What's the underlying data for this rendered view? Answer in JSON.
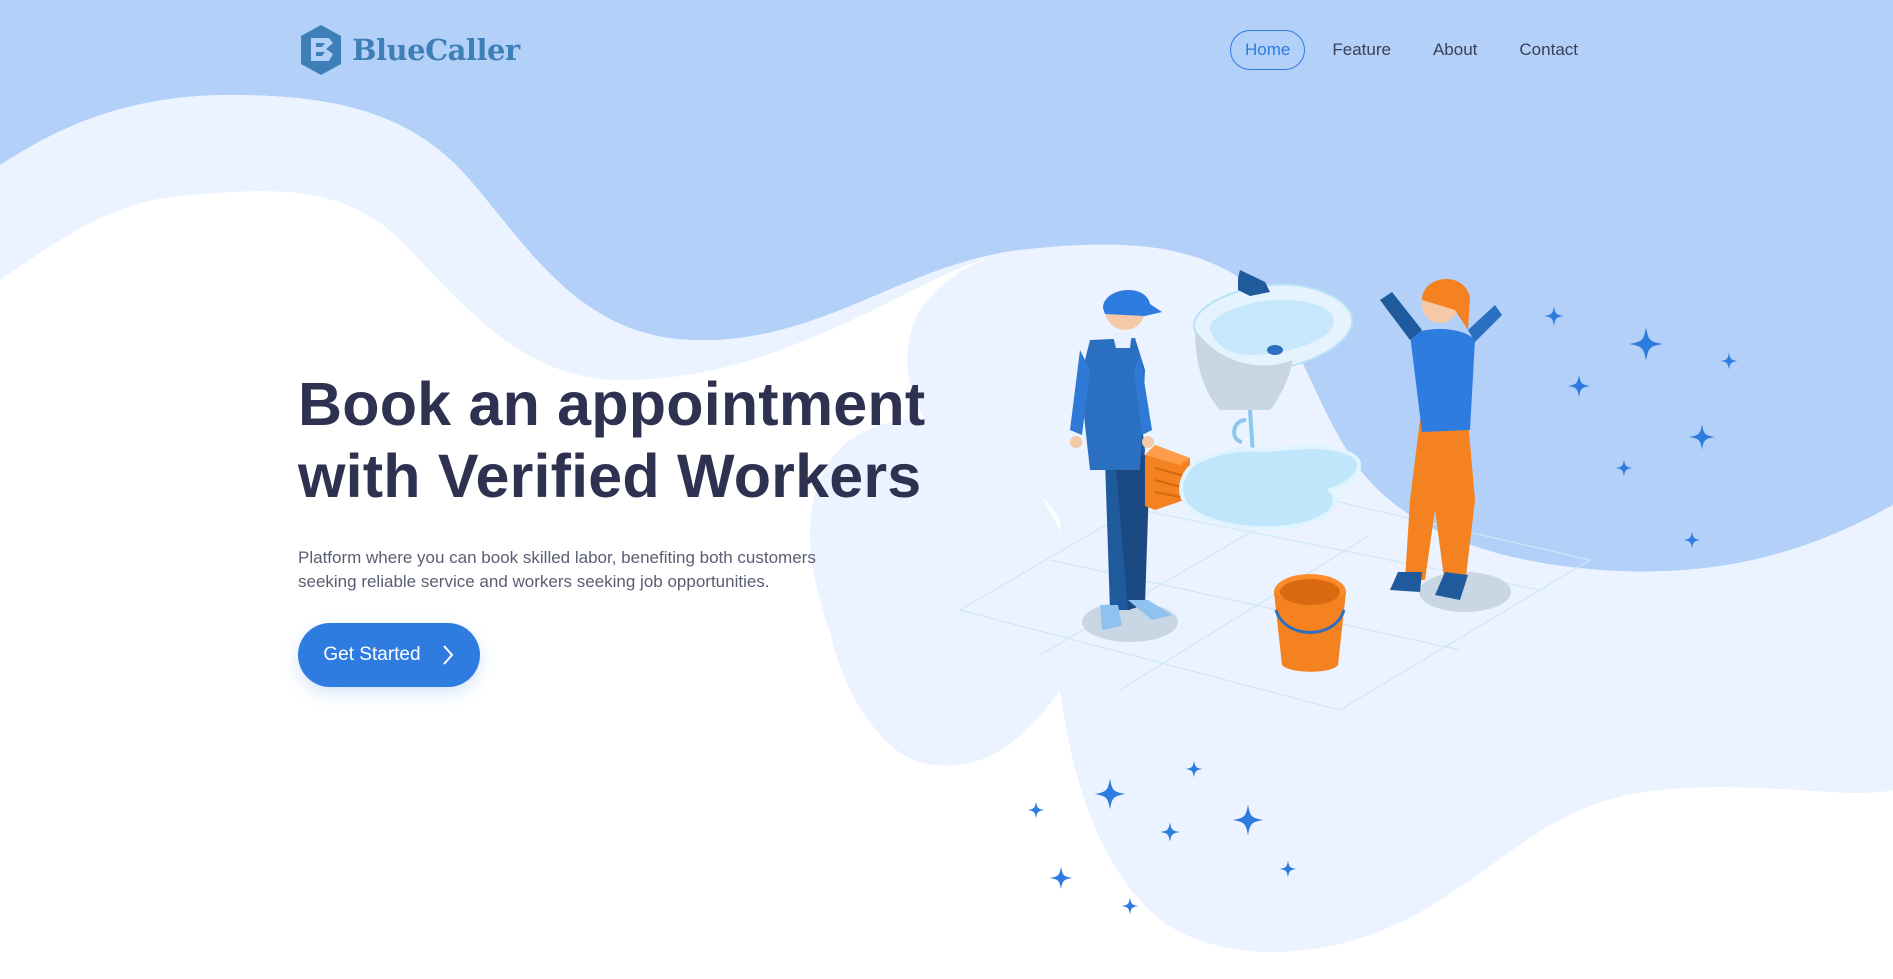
{
  "brand": {
    "name": "BlueCaller",
    "logo_icon": "hexagon-b-logo-icon",
    "color": "#3f7fb8"
  },
  "nav": {
    "items": [
      {
        "label": "Home",
        "active": true
      },
      {
        "label": "Feature",
        "active": false
      },
      {
        "label": "About",
        "active": false
      },
      {
        "label": "Contact",
        "active": false
      }
    ]
  },
  "hero": {
    "title_line1": "Book an appointment",
    "title_line2": "with Verified Workers",
    "subtitle_line1": "Platform where you can book skilled labor, benefiting both customers",
    "subtitle_line2": "seeking reliable service and workers seeking job opportunities.",
    "cta_label": "Get Started",
    "cta_icon": "chevron-right-icon"
  },
  "colors": {
    "accent": "#2f7ce0",
    "background_top": "#b3d0f8",
    "background_light": "#eaf3ff",
    "heading": "#2e3150",
    "text": "#5a5e73",
    "orange": "#f58220"
  },
  "illustration": {
    "icons": [
      "plumber-icon",
      "leaking-sink-icon",
      "water-puddle-icon",
      "bucket-icon",
      "worried-woman-icon",
      "sparkle-icon"
    ]
  }
}
